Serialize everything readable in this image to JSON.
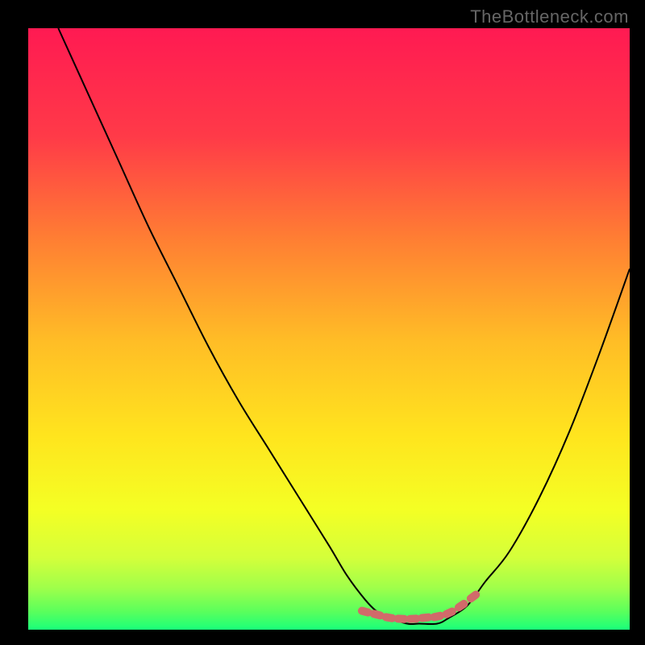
{
  "watermark": "TheBottleneck.com",
  "chart_data": {
    "type": "line",
    "title": "",
    "xlabel": "",
    "ylabel": "",
    "xlim": [
      0,
      100
    ],
    "ylim": [
      0,
      100
    ],
    "background_gradient": {
      "top": "#ff1a52",
      "mid_upper": "#ff8c2e",
      "mid": "#ffdb1a",
      "mid_lower": "#e6ff33",
      "bottom": "#1aff7a"
    },
    "series": [
      {
        "name": "curve",
        "x": [
          5,
          10,
          15,
          20,
          25,
          30,
          35,
          40,
          45,
          50,
          53,
          56,
          58,
          60,
          63,
          65,
          68,
          70,
          73,
          76,
          80,
          85,
          90,
          95,
          100
        ],
        "y": [
          100,
          89,
          78,
          67,
          57,
          47,
          38,
          30,
          22,
          14,
          9,
          5,
          3,
          2,
          1,
          1,
          1,
          2,
          4,
          8,
          13,
          22,
          33,
          46,
          60
        ]
      },
      {
        "name": "markers",
        "type": "scatter",
        "x": [
          56,
          58,
          60,
          62,
          64,
          66,
          68,
          70,
          72,
          74
        ],
        "y": [
          3,
          2.5,
          2,
          1.8,
          1.8,
          2,
          2.2,
          2.8,
          4,
          5.5
        ],
        "marker_color": "#d16a6a"
      }
    ]
  }
}
